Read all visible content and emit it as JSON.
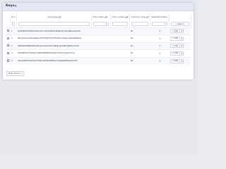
{
  "modal": {
    "title": "Keys",
    "close_icon": "✕"
  },
  "table": {
    "columns": [
      {
        "label": "ID",
        "arrow": "⇅",
        "sorted": true
      },
      {
        "label": "Serial keys",
        "arrow": "▲▼"
      },
      {
        "label": "Order status",
        "arrow": "▲▼"
      },
      {
        "label": "Order number",
        "arrow": "▲▼"
      },
      {
        "label": "Customer name",
        "arrow": "▲▼"
      },
      {
        "label": "Selectable status",
        "arrow": ""
      }
    ],
    "search_label": "Search",
    "rows": [
      {
        "id": "1",
        "key": "Q2jXtNFB5KDbGH5WhjLSGrYwsT4Z9KHmNfS8pWTnRxqBNxGeKEmtr",
        "status": "No",
        "edit": "Edit"
      },
      {
        "id": "2",
        "key": "R4uKmHbwuZXfrp6NqumHHVNtyD5QmPFLZTcbvKGJQnWgPuBWeBrst",
        "status": "No",
        "edit": "Edit"
      },
      {
        "id": "3",
        "key": "QfMK5ZDtRBNUf2Dq8VsAGsdrKZdQbYtq8MJnhpH9EC9gNRCnVsDm",
        "status": "No",
        "edit": "Edit"
      },
      {
        "id": "4",
        "key": "ZbXPZ8TXnUTNUQnm6WSQNfCNARmb4kYDcFKmeQqzb7Vnrg",
        "status": "No",
        "edit": "Edit"
      },
      {
        "id": "5",
        "key": "S4pQcNEbd5XzkFyQ7t3Kbm9Xa9CRPfMy2rXwRgMpBEdgkXsUdTk",
        "status": "No",
        "edit": "Edit"
      }
    ]
  },
  "bulk_actions_label": "Bulk actions"
}
